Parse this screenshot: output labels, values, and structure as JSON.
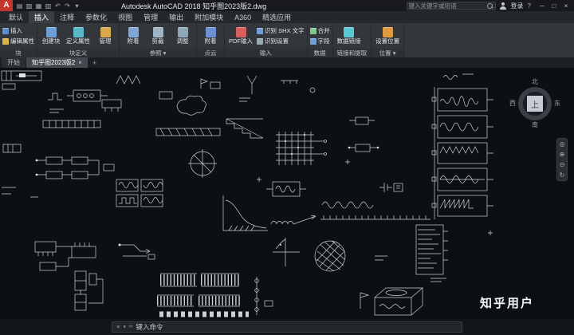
{
  "colors": {
    "accent_red": "#c4352c",
    "canvas_background": "#0c0f14",
    "ribbon_background": "#33373c"
  },
  "titlebar": {
    "logo_text": "A",
    "title": "Autodesk AutoCAD 2018   知乎图2023版2.dwg",
    "search_placeholder": "键入关键字或短语",
    "signin_label": "登录",
    "help_glyph": "?",
    "quick_icons": [
      {
        "name": "new-file-icon",
        "glyph": "▤"
      },
      {
        "name": "open-file-icon",
        "glyph": "▧"
      },
      {
        "name": "save-icon",
        "glyph": "▦"
      },
      {
        "name": "print-icon",
        "glyph": "▥"
      },
      {
        "name": "undo-icon",
        "glyph": "↶"
      },
      {
        "name": "redo-icon",
        "glyph": "↷"
      },
      {
        "name": "workspace-dropdown-icon",
        "glyph": "▾"
      }
    ],
    "window_controls": [
      {
        "name": "minimize-button",
        "glyph": "─"
      },
      {
        "name": "maximize-button",
        "glyph": "□"
      },
      {
        "name": "close-button",
        "glyph": "×"
      }
    ]
  },
  "ribbon": {
    "tabs": [
      {
        "label": "默认",
        "active": false
      },
      {
        "label": "插入",
        "active": true
      },
      {
        "label": "注释",
        "active": false
      },
      {
        "label": "参数化",
        "active": false
      },
      {
        "label": "视图",
        "active": false
      },
      {
        "label": "管理",
        "active": false
      },
      {
        "label": "输出",
        "active": false
      },
      {
        "label": "附加模块",
        "active": false
      },
      {
        "label": "A360",
        "active": false
      },
      {
        "label": "精选应用",
        "active": false
      }
    ],
    "panels": [
      {
        "label": "块",
        "dropdown": false,
        "buttons": [
          {
            "name": "insert-block-button",
            "icon": "insert-block-icon",
            "label": "插入",
            "color": "#5b8fc9",
            "big": false
          },
          {
            "name": "edit-attribute-button",
            "icon": "edit-attribute-icon",
            "label": "编辑属性",
            "color": "#d9b44a",
            "big": false
          }
        ]
      },
      {
        "label": "块定义",
        "dropdown": false,
        "buttons": [
          {
            "name": "create-block-button",
            "icon": "create-block-icon",
            "label": "创建块",
            "color": "#6d9fd4",
            "big": true
          },
          {
            "name": "define-attributes-button",
            "icon": "define-attributes-icon",
            "label": "定义属性",
            "color": "#5bb8c9",
            "big": true
          },
          {
            "name": "manage-attributes-button",
            "icon": "manage-attributes-icon",
            "label": "管理",
            "color": "#d9a84a",
            "big": true
          }
        ]
      },
      {
        "label": "参照",
        "dropdown": true,
        "buttons": [
          {
            "name": "attach-reference-button",
            "icon": "attach-reference-icon",
            "label": "附着",
            "color": "#7fa8d9",
            "big": true
          },
          {
            "name": "clip-button",
            "icon": "clip-icon",
            "label": "剪裁",
            "color": "#9fb4c4",
            "big": true
          },
          {
            "name": "adjust-button",
            "icon": "adjust-icon",
            "label": "调整",
            "color": "#8fa8b8",
            "big": true
          }
        ]
      },
      {
        "label": "点云",
        "dropdown": false,
        "buttons": [
          {
            "name": "pointcloud-attach-button",
            "icon": "pointcloud-attach-icon",
            "label": "附着",
            "color": "#6d8fd4",
            "big": true
          }
        ]
      },
      {
        "label": "输入",
        "dropdown": false,
        "buttons": [
          {
            "name": "pdf-import-button",
            "icon": "pdf-import-icon",
            "label": "PDF输入",
            "color": "#d95f5f",
            "big": true
          },
          {
            "name": "recognize-shx-button",
            "icon": "recognize-shx-icon",
            "label": "识别 SHX 文字",
            "color": "#6d9fd4",
            "big": false
          },
          {
            "name": "recognition-settings-button",
            "icon": "recognition-settings-icon",
            "label": "识别设置",
            "color": "#9aa8b0",
            "big": false
          }
        ]
      },
      {
        "label": "数据",
        "dropdown": false,
        "buttons": [
          {
            "name": "combine-button",
            "icon": "combine-icon",
            "label": "合并",
            "color": "#7fc98f",
            "big": false
          },
          {
            "name": "field-button",
            "icon": "field-icon",
            "label": "字段",
            "color": "#6d9fd4",
            "big": false
          }
        ]
      },
      {
        "label": "链接和提取",
        "dropdown": false,
        "buttons": [
          {
            "name": "data-link-button",
            "icon": "data-link-icon",
            "label": "数据链接",
            "color": "#5bc9d4",
            "big": true
          }
        ]
      },
      {
        "label": "位置",
        "dropdown": true,
        "buttons": [
          {
            "name": "set-location-button",
            "icon": "set-location-icon",
            "label": "设置位置",
            "color": "#e09a3f",
            "big": true
          }
        ]
      }
    ]
  },
  "doc_tabs": {
    "close_glyph": "×",
    "new_tab_glyph": "+",
    "tabs": [
      {
        "label": "开始",
        "active": false,
        "closable": false
      },
      {
        "label": "知乎图2023版2",
        "active": true,
        "closable": true
      }
    ]
  },
  "canvas": {
    "watermark": "知乎用户",
    "viewcube": {
      "north": "北",
      "south": "南",
      "west": "西",
      "east": "东",
      "top": "上"
    },
    "navbar_icons": [
      {
        "name": "navigation-wheel-icon",
        "glyph": "◎"
      },
      {
        "name": "pan-hand-icon",
        "glyph": "⊕"
      },
      {
        "name": "zoom-icon",
        "glyph": "⊙"
      },
      {
        "name": "orbit-icon",
        "glyph": "↻"
      }
    ]
  },
  "command_bar": {
    "command_text": "键入命令",
    "icons": [
      {
        "name": "close-command-icon",
        "glyph": "×"
      },
      {
        "name": "customize-command-icon",
        "glyph": "▾"
      },
      {
        "name": "keyboard-icon",
        "glyph": "⌨"
      }
    ]
  }
}
